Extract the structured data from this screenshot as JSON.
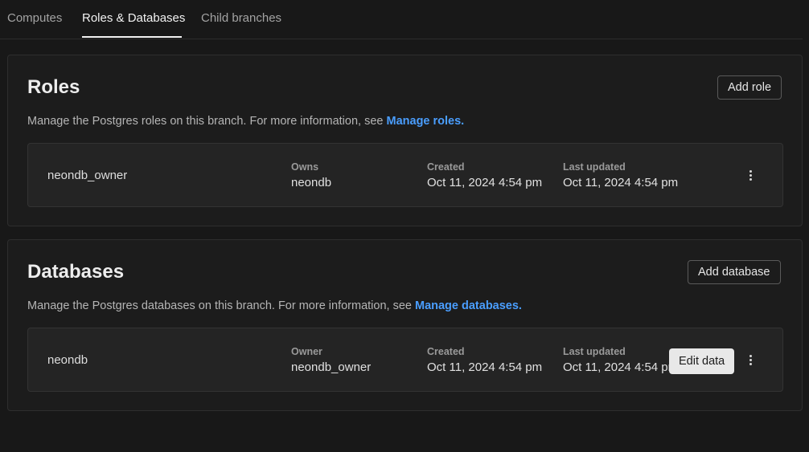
{
  "tabs": [
    {
      "label": "Computes",
      "active": false
    },
    {
      "label": "Roles & Databases",
      "active": true
    },
    {
      "label": "Child branches",
      "active": false
    }
  ],
  "roles": {
    "title": "Roles",
    "add_button": "Add role",
    "description": "Manage the Postgres roles on this branch. For more information, see ",
    "link_text": "Manage roles.",
    "items": [
      {
        "name": "neondb_owner",
        "col1_label": "Owns",
        "col1_value": "neondb",
        "created_label": "Created",
        "created_value": "Oct 11, 2024 4:54 pm",
        "updated_label": "Last updated",
        "updated_value": "Oct 11, 2024 4:54 pm"
      }
    ]
  },
  "databases": {
    "title": "Databases",
    "add_button": "Add database",
    "description": "Manage the Postgres databases on this branch. For more information, see ",
    "link_text": "Manage databases.",
    "items": [
      {
        "name": "neondb",
        "col1_label": "Owner",
        "col1_value": "neondb_owner",
        "created_label": "Created",
        "created_value": "Oct 11, 2024 4:54 pm",
        "updated_label": "Last updated",
        "updated_value": "Oct 11, 2024 4:54 pm",
        "edit_button": "Edit data"
      }
    ]
  },
  "icons": {
    "row_menu": "more-vertical-icon"
  }
}
